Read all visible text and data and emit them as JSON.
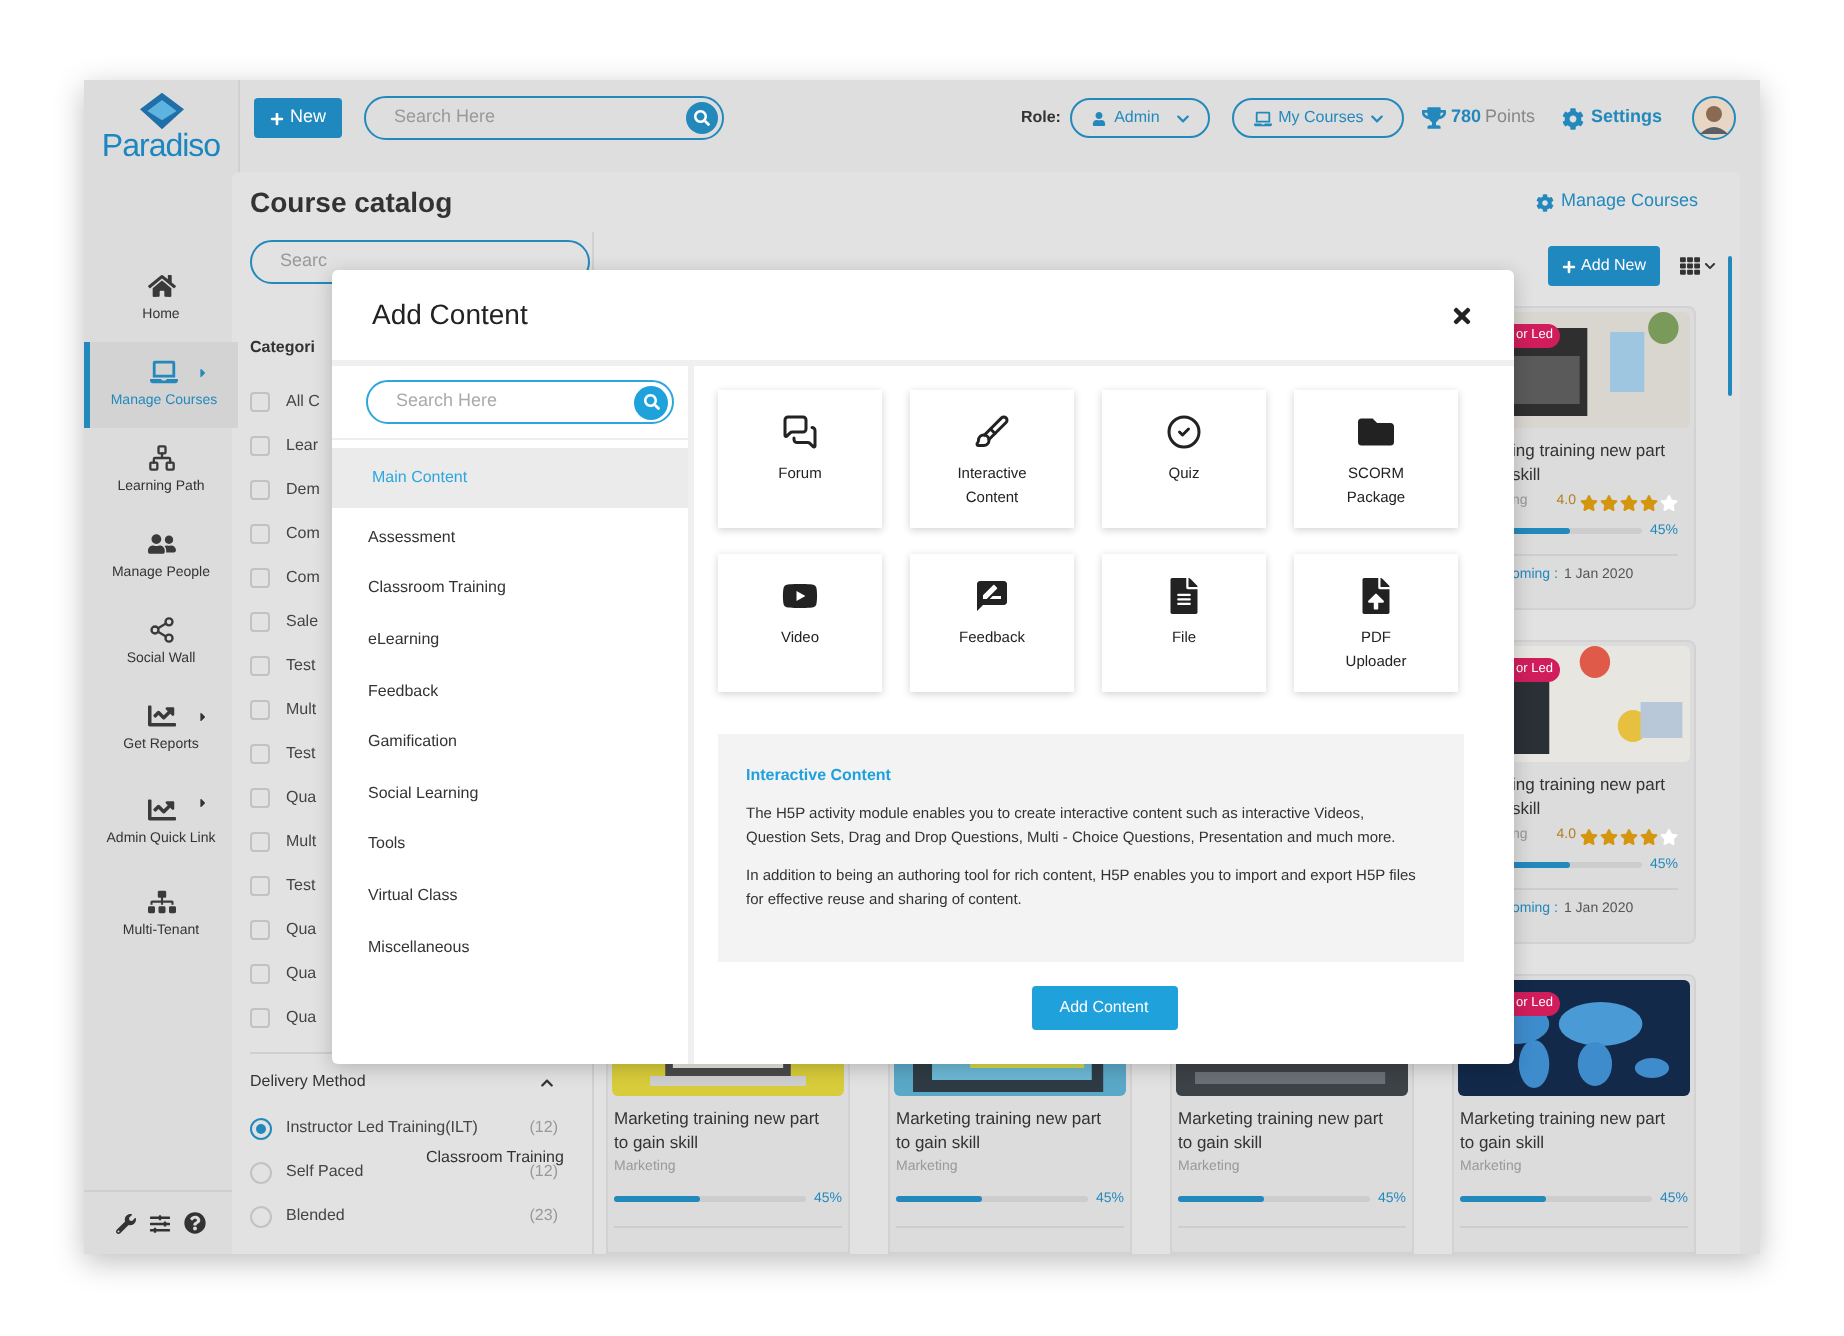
{
  "brand": {
    "name": "Paradiso"
  },
  "sidebar": {
    "items": [
      {
        "label": "Home",
        "selected": false,
        "submenu": false
      },
      {
        "label": "Manage Courses",
        "selected": true,
        "submenu": true
      },
      {
        "label": "Learning Path",
        "selected": false,
        "submenu": false
      },
      {
        "label": "Manage People",
        "selected": false,
        "submenu": false
      },
      {
        "label": "Social Wall",
        "selected": false,
        "submenu": false
      },
      {
        "label": "Get Reports",
        "selected": false,
        "submenu": true
      },
      {
        "label": "Admin Quick Link",
        "selected": false,
        "submenu": true
      },
      {
        "label": "Multi-Tenant",
        "selected": false,
        "submenu": false
      }
    ]
  },
  "topbar": {
    "new_button": "New",
    "search": {
      "placeholder": "Search Here"
    },
    "role_label": "Role:",
    "role": "Admin",
    "courses_menu": "My Courses",
    "points_value": "780",
    "points_label": "Points",
    "settings": "Settings"
  },
  "page": {
    "title": "Course catalog",
    "manage_link": "Manage Courses",
    "search": {
      "placeholder": "Searc"
    },
    "add_new": "Add New"
  },
  "filters": {
    "categories_title": "Categori",
    "categories": [
      {
        "label": "All C",
        "checked": false
      },
      {
        "label": "Lear",
        "checked": false
      },
      {
        "label": "Dem",
        "checked": false
      },
      {
        "label": "Com",
        "checked": false
      },
      {
        "label": "Com",
        "checked": false
      },
      {
        "label": "Sale",
        "checked": false
      },
      {
        "label": "Test",
        "checked": false
      },
      {
        "label": "Mult",
        "checked": false
      },
      {
        "label": "Test",
        "checked": false
      },
      {
        "label": "Qua",
        "checked": false
      },
      {
        "label": "Mult",
        "checked": false
      },
      {
        "label": "Test",
        "checked": false
      },
      {
        "label": "Qua",
        "checked": false
      },
      {
        "label": "Qua",
        "checked": false
      },
      {
        "label": "Qua",
        "checked": false
      }
    ],
    "delivery_title": "Delivery Method",
    "delivery_expanded": true,
    "delivery": [
      {
        "label": "Instructor Led Training(ILT)",
        "count": "(12)",
        "selected": true
      },
      {
        "label": "Self Paced",
        "count": "(12)",
        "selected": false
      },
      {
        "label": "Blended",
        "count": "(23)",
        "selected": false
      }
    ]
  },
  "drag_label": "Classroom Training",
  "side_cards": [
    {
      "badge": "or Led",
      "title_lines": [
        "ing training new part",
        "skill"
      ],
      "category": "ng",
      "rating": "4.0",
      "stars": 4,
      "level": 0.45,
      "percent": "45%",
      "upcoming_label": "oming :",
      "date": "1 Jan 2020"
    },
    {
      "badge": "or Led",
      "title_lines": [
        "ing training new part",
        "skill"
      ],
      "category": "ng",
      "rating": "4.0",
      "stars": 4,
      "level": 0.45,
      "percent": "45%",
      "upcoming_label": "oming :",
      "date": "1 Jan 2020"
    }
  ],
  "bottom_cards": [
    {
      "title": "Marketing training new part to gain skill",
      "category": "Marketing",
      "level": 0.45,
      "percent": "45%"
    },
    {
      "title": "Marketing training new part to gain skill",
      "category": "Marketing",
      "level": 0.45,
      "percent": "45%"
    },
    {
      "title": "Marketing training new part to gain skill",
      "category": "Marketing",
      "level": 0.45,
      "percent": "45%"
    },
    {
      "badge": "or Led",
      "title": "Marketing training new part to gain skill",
      "category": "Marketing",
      "level": 0.45,
      "percent": "45%"
    }
  ],
  "modal": {
    "title": "Add Content",
    "search": {
      "placeholder": "Search Here"
    },
    "categories": [
      {
        "label": "Main Content",
        "selected": true
      },
      {
        "label": "Assessment",
        "selected": false
      },
      {
        "label": "Classroom Training",
        "selected": false
      },
      {
        "label": "eLearning",
        "selected": false
      },
      {
        "label": "Feedback",
        "selected": false
      },
      {
        "label": "Gamification",
        "selected": false
      },
      {
        "label": "Social Learning",
        "selected": false
      },
      {
        "label": "Tools",
        "selected": false
      },
      {
        "label": "Virtual Class",
        "selected": false
      },
      {
        "label": "Miscellaneous",
        "selected": false
      }
    ],
    "tiles": [
      {
        "label": "Forum",
        "kind": "forum"
      },
      {
        "label": "Interactive Content",
        "kind": "interactive"
      },
      {
        "label": "Quiz",
        "kind": "quiz"
      },
      {
        "label": "SCORM Package",
        "kind": "scorm"
      },
      {
        "label": "Video",
        "kind": "video"
      },
      {
        "label": "Feedback",
        "kind": "feedback"
      },
      {
        "label": "File",
        "kind": "file"
      },
      {
        "label": "PDF Uploader",
        "kind": "pdf"
      }
    ],
    "info": {
      "title": "Interactive Content",
      "paragraphs": [
        "The H5P activity module enables you to create interactive content such as interactive Videos, Question Sets, Drag and Drop Questions, Multi - Choice Questions, Presentation and much more.",
        "In addition to being an authoring tool for rich content, H5P enables you to import and export H5P files for effective reuse and sharing of content."
      ]
    },
    "submit": "Add Content"
  }
}
